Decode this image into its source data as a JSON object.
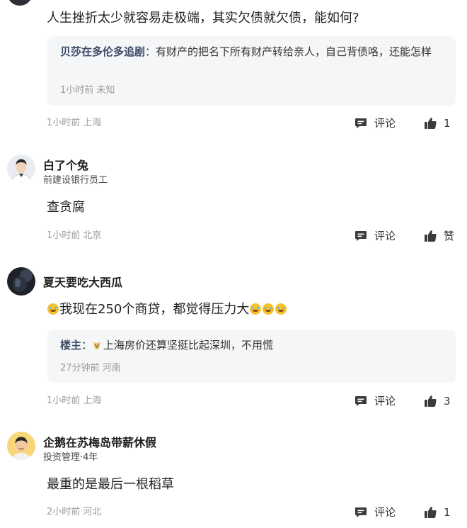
{
  "colors": {
    "meta": "#9a9a9a",
    "reply_bg": "#f5f6f8",
    "reply_author": "#3c4a67",
    "icon": "#3b3b3b"
  },
  "comments": [
    {
      "text": "人生挫折太少就容易走极端，其实欠债就欠债，能如何?",
      "reply": {
        "author": "贝莎在多伦多追剧",
        "sep": "：",
        "text": "有财产的把名下所有财产转给亲人，自己背债咯，还能怎样",
        "time": "1小时前",
        "location": "未知"
      },
      "time": "1小时前",
      "location": "上海",
      "comment_label": "评论",
      "like_label": "1"
    },
    {
      "name": "白了个兔",
      "tag": "前建设银行员工",
      "text": "查贪腐",
      "time": "1小时前",
      "location": "北京",
      "comment_label": "评论",
      "like_label": "赞"
    },
    {
      "name": "夏天要吃大西瓜",
      "text_emoji": "tears-of-joy-emoji",
      "text": "我现在250个商贷，都觉得压力大",
      "reply": {
        "author": "楼主",
        "sep": "：",
        "emoji": "dog-face-emoji",
        "text": "上海房价还算坚挺比起深圳，不用慌",
        "time": "27分钟前",
        "location": "河南"
      },
      "time": "1小时前",
      "location": "上海",
      "comment_label": "评论",
      "like_label": "3"
    },
    {
      "name": "企鹅在苏梅岛带薪休假",
      "tag": "投资管理",
      "tag_sep": "·",
      "tag_years": "4年",
      "text": "最重的是最后一根稻草",
      "time": "2小时前",
      "location": "河北",
      "comment_label": "评论",
      "like_label": "1"
    }
  ]
}
